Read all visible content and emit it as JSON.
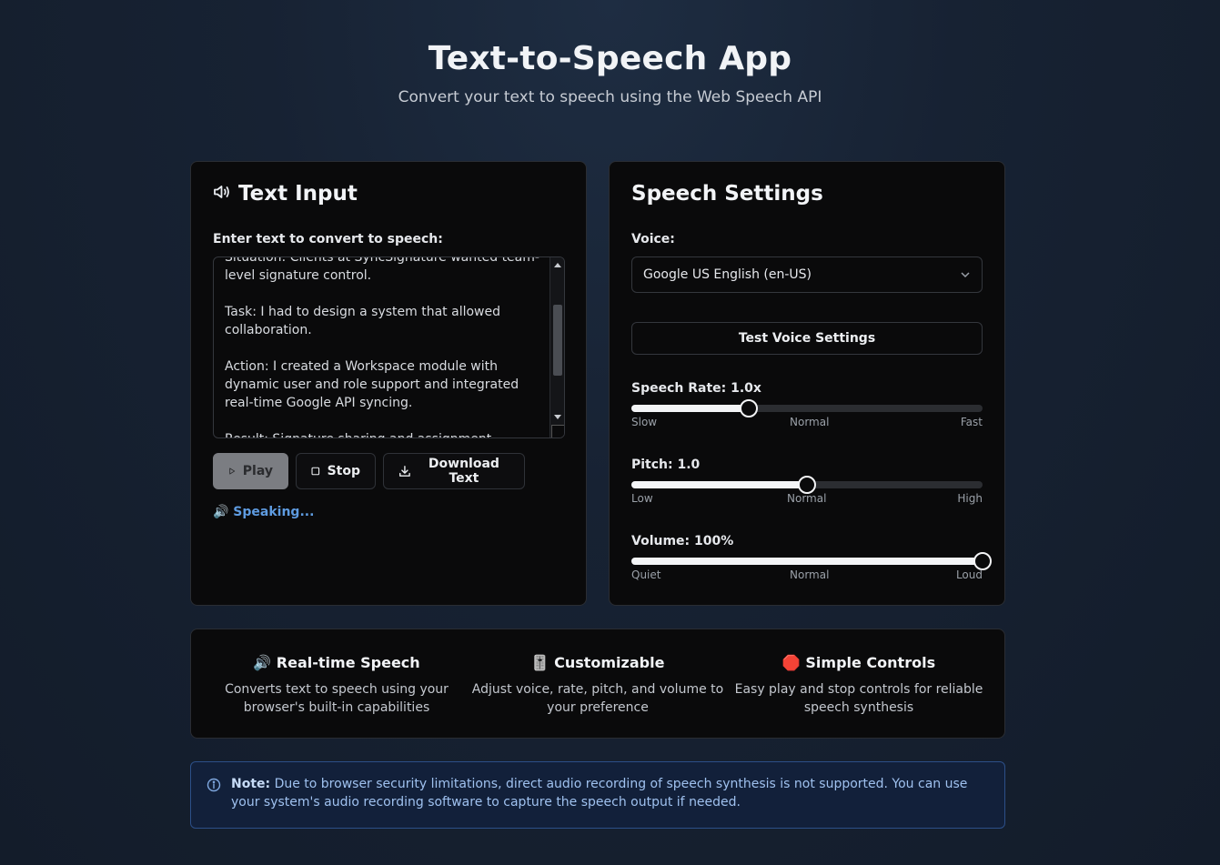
{
  "header": {
    "title": "Text-to-Speech App",
    "subtitle": "Convert your text to speech using the Web Speech API"
  },
  "text_input": {
    "title": "Text Input",
    "label": "Enter text to convert to speech:",
    "text": "Situation: Clients at SyncSignature wanted team-level signature control.\n\nTask: I had to design a system that allowed collaboration.\n\nAction: I created a Workspace module with dynamic user and role support and integrated real-time Google API syncing.\n\nResult: Signature sharing and assignment became",
    "buttons": {
      "play": "Play",
      "stop": "Stop",
      "download": "Download Text"
    },
    "status": "🔊 Speaking..."
  },
  "settings": {
    "title": "Speech Settings",
    "voice_label": "Voice:",
    "voice_value": "Google US English (en-US)",
    "test_button": "Test Voice Settings",
    "rate": {
      "label": "Speech Rate: 1.0x",
      "value": 1.0,
      "min": 0.5,
      "max": 2.0,
      "ticks": [
        "Slow",
        "Normal",
        "Fast"
      ]
    },
    "pitch": {
      "label": "Pitch: 1.0",
      "value": 1.0,
      "min": 0,
      "max": 2,
      "ticks": [
        "Low",
        "Normal",
        "High"
      ]
    },
    "volume": {
      "label": "Volume: 100%",
      "value": 100,
      "min": 0,
      "max": 100,
      "ticks": [
        "Quiet",
        "Normal",
        "Loud"
      ]
    }
  },
  "features": [
    {
      "title": "🔊 Real-time Speech",
      "desc": "Converts text to speech using your browser's built-in capabilities"
    },
    {
      "title": "🎚️ Customizable",
      "desc": "Adjust voice, rate, pitch, and volume to your preference"
    },
    {
      "title": "🛑 Simple Controls",
      "desc": "Easy play and stop controls for reliable speech synthesis"
    }
  ],
  "note": {
    "label": "Note:",
    "text": " Due to browser security limitations, direct audio recording of speech synthesis is not supported. You can use your system's audio recording software to capture the speech output if needed."
  },
  "colors": {
    "accent": "#5e9be0",
    "note_bg": "#12203a",
    "panel_bg": "#0a0a0b"
  }
}
